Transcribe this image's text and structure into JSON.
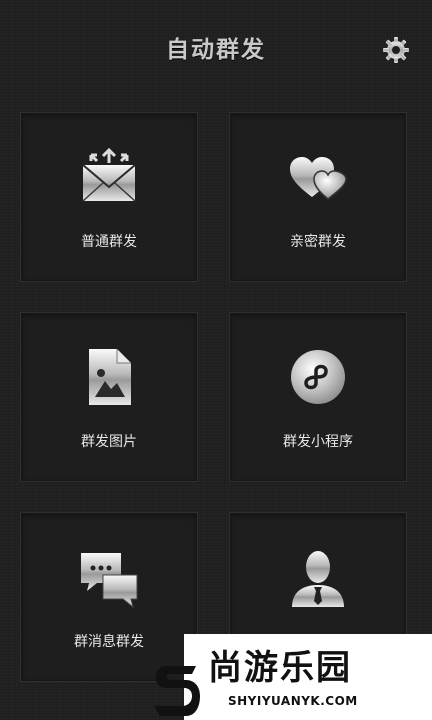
{
  "header": {
    "title": "自动群发",
    "settings_icon": "gear-icon"
  },
  "tiles": [
    {
      "label": "普通群发",
      "icon": "envelope-arrows-icon"
    },
    {
      "label": "亲密群发",
      "icon": "hearts-icon"
    },
    {
      "label": "群发图片",
      "icon": "image-file-icon"
    },
    {
      "label": "群发小程序",
      "icon": "mini-program-icon"
    },
    {
      "label": "群消息群发",
      "icon": "chat-bubbles-icon"
    },
    {
      "label": "",
      "icon": "person-tie-icon"
    }
  ],
  "watermark": {
    "main": "尚游乐园",
    "sub": "SHYIYUANYK.COM"
  },
  "colors": {
    "background": "#1f1f1f",
    "tile_border": "#2f2f2f",
    "label": "#e6e6e6",
    "title": "#c9c9c9"
  }
}
